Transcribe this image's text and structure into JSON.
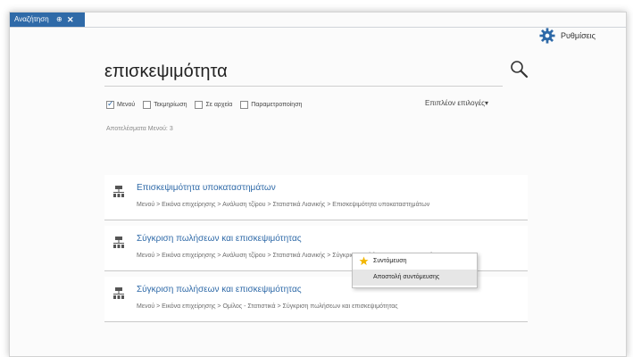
{
  "tab": {
    "label": "Αναζήτηση",
    "pin": "⊕",
    "close": "✕"
  },
  "settings": {
    "label": "Ρυθμίσεις"
  },
  "search": {
    "value": "επισκεψιμότητα"
  },
  "filters": [
    {
      "label": "Μενού",
      "checked": true
    },
    {
      "label": "Τεκμηρίωση",
      "checked": false
    },
    {
      "label": "Σε αρχεία",
      "checked": false
    },
    {
      "label": "Παραμετροποίηση",
      "checked": false
    }
  ],
  "more_options": "Επιπλέον επιλογές▾",
  "results_count": "Αποτελέσματα Μενού: 3",
  "results": [
    {
      "title": "Επισκεψιμότητα υποκαταστημάτων",
      "path": "Μενού > Εικόνα επιχείρησης > Ανάλυση τζίρου > Στατιστικά Λιανικής > Επισκεψιμότητα υποκαταστημάτων"
    },
    {
      "title": "Σύγκριση πωλήσεων και επισκεψιμότητας",
      "path": "Μενού > Εικόνα επιχείρησης > Ανάλυση τζίρου > Στατιστικά Λιανικής > Σύγκριση πωλήσεων και επισκεψιμότητας"
    },
    {
      "title": "Σύγκριση πωλήσεων και επισκεψιμότητας",
      "path": "Μενού > Εικόνα επιχείρησης > Ομίλος - Στατιστικά > Σύγκριση πωλήσεων και επισκεψιμότητας"
    }
  ],
  "context_menu": {
    "items": [
      "Συντόμευση",
      "Αποστολή συντόμευσης"
    ]
  },
  "colors": {
    "accent": "#2f6aa8",
    "tab_bg": "#2f6aa8",
    "star": "#f2b705"
  }
}
